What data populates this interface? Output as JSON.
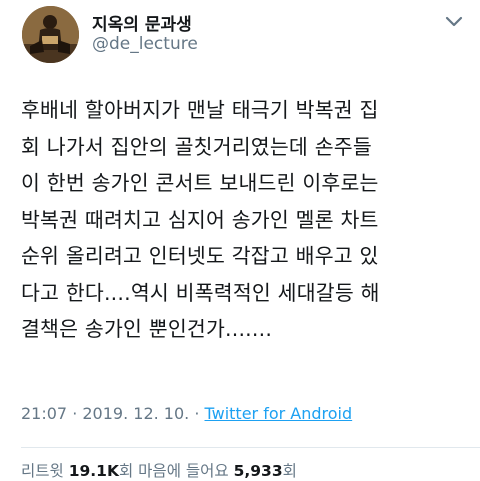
{
  "tweet": {
    "author": {
      "display_name": "지옥의 문과생",
      "handle": "@de_lecture"
    },
    "text_lines": [
      "후배네 할아버지가 맨날 태극기 박복권 집",
      "회 나가서 집안의 골칫거리였는데 손주들",
      "이 한번 송가인 콘서트 보내드린 이후로는",
      "박복권 때려치고 심지어 송가인 멜론 차트",
      "순위 올리려고 인터넷도 각잡고 배우고 있",
      "다고 한다....역시 비폭력적인 세대갈등 해",
      "결책은 송가인 뿐인건가......."
    ],
    "timestamp": "21:07 · 2019. 12. 10. · ",
    "source": "Twitter for Android",
    "stats": {
      "retweets_label": "리트윗 ",
      "retweets_count": "19.1K",
      "retweets_suffix": "회 ",
      "likes_label": "마음에 들어요 ",
      "likes_count": "5,933",
      "likes_suffix": "회"
    }
  },
  "icons": {
    "menu": "chevron-down-icon",
    "avatar": "avatar-image"
  }
}
